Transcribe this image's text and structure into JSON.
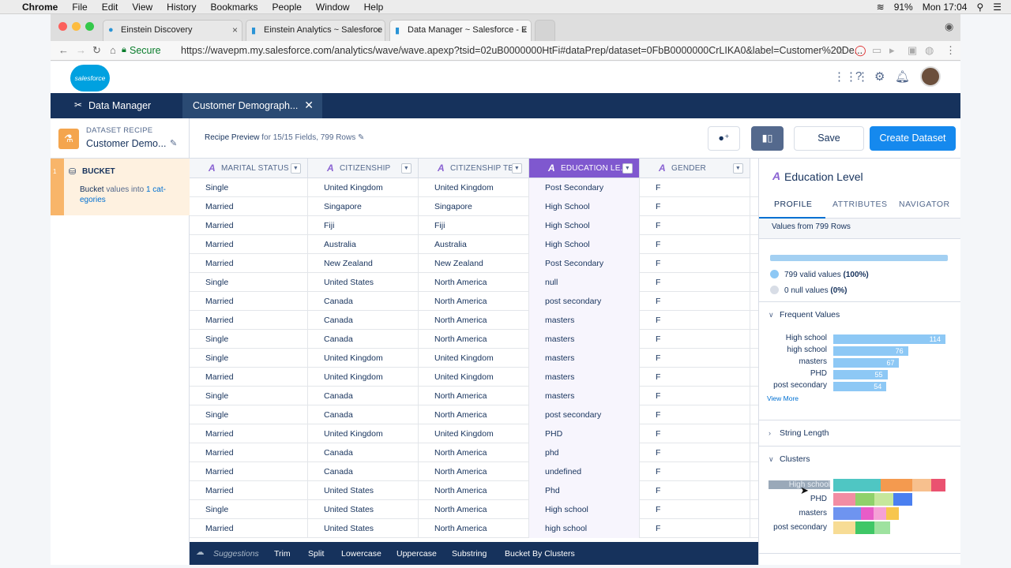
{
  "macmenu": {
    "app": "Chrome",
    "items": [
      "File",
      "Edit",
      "View",
      "History",
      "Bookmarks",
      "People",
      "Window",
      "Help"
    ],
    "battery": "91%",
    "time": "Mon 17:04"
  },
  "browser": {
    "tabs": [
      "Einstein Discovery",
      "Einstein Analytics ~ Salesforce",
      "Data Manager ~ Salesforce - E"
    ],
    "secure": "Secure",
    "url": "https://wavepm.my.salesforce.com/analytics/wave/wave.apexp?tsid=02uB0000000HtFi#dataPrep/dataset=0FbB0000000CrLIKA0&label=Customer%20De..."
  },
  "logo": "salesforce",
  "nav": {
    "app": "Data Manager",
    "tab": "Customer Demograph..."
  },
  "recipe": {
    "label": "DATASET RECIPE",
    "name": "Customer Demo...",
    "preview_title": "Recipe Preview",
    "preview_rest": " for 15/15 Fields, 799 Rows",
    "save": "Save",
    "create": "Create Dataset"
  },
  "step": {
    "num": "1",
    "title": "BUCKET",
    "desc_bold": "Bucket",
    "desc_rest": " values into ",
    "desc_link": "1 cat-egories"
  },
  "grid": {
    "headers": [
      "MARITAL STATUS",
      "CITIZENSHIP",
      "CITIZENSHIP TE...",
      "EDUCATION LE...",
      "GENDER"
    ],
    "rows": [
      [
        "Single",
        "United Kingdom",
        "United Kingdom",
        "Post Secondary",
        "F"
      ],
      [
        "Married",
        "Singapore",
        "Singapore",
        "High School",
        "F"
      ],
      [
        "Married",
        "Fiji",
        "Fiji",
        "High School",
        "F"
      ],
      [
        "Married",
        "Australia",
        "Australia",
        "High School",
        "F"
      ],
      [
        "Married",
        "New Zealand",
        "New Zealand",
        "Post Secondary",
        "F"
      ],
      [
        "Single",
        "United States",
        "North America",
        "null",
        "F"
      ],
      [
        "Married",
        "Canada",
        "North America",
        "post secondary",
        "F"
      ],
      [
        "Married",
        "Canada",
        "North America",
        "masters",
        "F"
      ],
      [
        "Single",
        "Canada",
        "North America",
        "masters",
        "F"
      ],
      [
        "Single",
        "United Kingdom",
        "United Kingdom",
        "masters",
        "F"
      ],
      [
        "Married",
        "United Kingdom",
        "United Kingdom",
        "masters",
        "F"
      ],
      [
        "Single",
        "Canada",
        "North America",
        "masters",
        "F"
      ],
      [
        "Single",
        "Canada",
        "North America",
        "post secondary",
        "F"
      ],
      [
        "Married",
        "United Kingdom",
        "United Kingdom",
        "PHD",
        "F"
      ],
      [
        "Married",
        "Canada",
        "North America",
        "phd",
        "F"
      ],
      [
        "Married",
        "Canada",
        "North America",
        "undefined",
        "F"
      ],
      [
        "Married",
        "United States",
        "North America",
        "Phd",
        "F"
      ],
      [
        "Single",
        "United States",
        "North America",
        "High school",
        "F"
      ],
      [
        "Married",
        "United States",
        "North America",
        "high school",
        "F"
      ]
    ]
  },
  "suggestions": {
    "label": "Suggestions",
    "items": [
      "Trim",
      "Split",
      "Lowercase",
      "Uppercase",
      "Substring",
      "Bucket By Clusters"
    ]
  },
  "panel": {
    "title": "Education Level",
    "tabs": [
      "PROFILE",
      "ATTRIBUTES",
      "NAVIGATOR"
    ],
    "values_from": "Values from 799 Rows",
    "valid": "799 valid values ",
    "valid_pct": "(100%)",
    "null": "0 null values ",
    "null_pct": "(0%)",
    "frequent_title": "Frequent Values",
    "frequent": [
      {
        "label": "High school",
        "count": "114",
        "v": 114
      },
      {
        "label": "high school",
        "count": "76",
        "v": 76
      },
      {
        "label": "masters",
        "count": "67",
        "v": 67
      },
      {
        "label": "PHD",
        "count": "55",
        "v": 55
      },
      {
        "label": "post secondary",
        "count": "54",
        "v": 54
      }
    ],
    "view_more": "View More",
    "string_length": "String Length",
    "clusters_title": "Clusters",
    "clusters": [
      {
        "label": "High school",
        "segs": [
          [
            "#4fc6c3",
            60
          ],
          [
            "#f49a4f",
            40
          ],
          [
            "#f7c08e",
            24
          ],
          [
            "#ea5270",
            18
          ]
        ]
      },
      {
        "label": "PHD",
        "segs": [
          [
            "#f28da3",
            28
          ],
          [
            "#8fd16b",
            24
          ],
          [
            "#c6e79c",
            24
          ],
          [
            "#4a7ff0",
            24
          ]
        ]
      },
      {
        "label": "masters",
        "segs": [
          [
            "#6e94f0",
            35
          ],
          [
            "#e85cc8",
            16
          ],
          [
            "#f5a1d6",
            16
          ],
          [
            "#f7c64e",
            16
          ]
        ]
      },
      {
        "label": "post secondary",
        "segs": [
          [
            "#f7dc95",
            28
          ],
          [
            "#3fc766",
            24
          ],
          [
            "#9ee29f",
            20
          ]
        ]
      }
    ]
  }
}
